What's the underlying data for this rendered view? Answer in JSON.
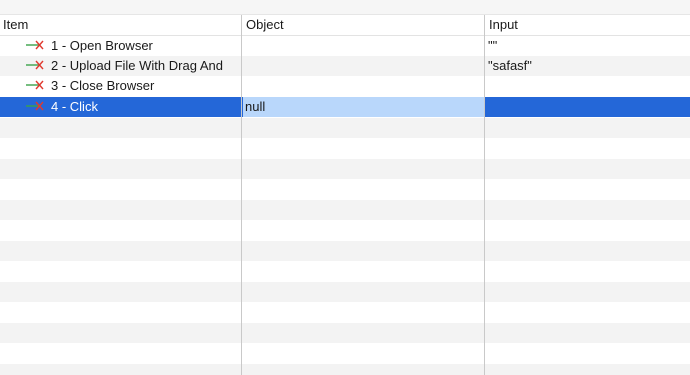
{
  "columns": {
    "item": "Item",
    "object": "Object",
    "input": "Input"
  },
  "rows": [
    {
      "item": "1 - Open Browser",
      "object": "",
      "input": "\"\"",
      "icon": "failed-step-icon"
    },
    {
      "item": "2 - Upload File With Drag And",
      "object": "",
      "input": "\"safasf\"",
      "icon": "failed-step-icon"
    },
    {
      "item": "3 - Close Browser",
      "object": "",
      "input": "",
      "icon": "failed-step-icon"
    },
    {
      "item": "4 - Click",
      "object": "null",
      "input": "",
      "icon": "failed-step-icon",
      "selected": true
    }
  ],
  "colors": {
    "selection": "#2467d8",
    "editing_cell": "#b9d7fb",
    "status_line": "#3aa34a",
    "status_x": "#e03a2f"
  }
}
